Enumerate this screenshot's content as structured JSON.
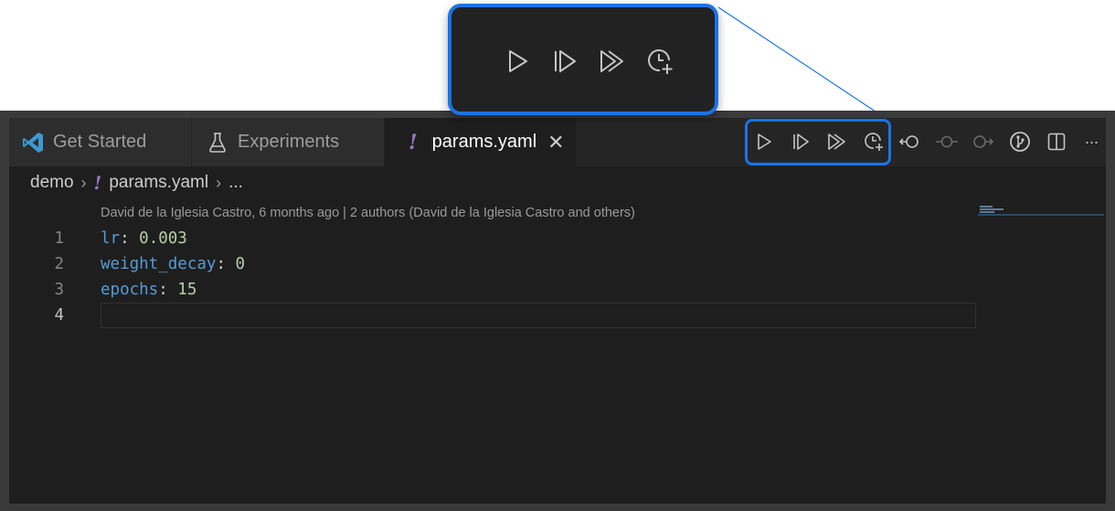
{
  "tabs": [
    {
      "label": "Get Started",
      "icon": "vscode-logo-icon",
      "active": false
    },
    {
      "label": "Experiments",
      "icon": "flask-icon",
      "active": false
    },
    {
      "label": "params.yaml",
      "icon": "yaml-file-icon",
      "active": true
    }
  ],
  "file_icon_glyph": "!",
  "close_glyph": "✕",
  "toolbar_icons": [
    "run-experiment-icon",
    "resume-experiment-icon",
    "run-all-experiments-icon",
    "queue-experiment-icon",
    "go-back-icon",
    "git-commit-icon",
    "go-forward-icon",
    "source-control-graph-icon",
    "split-editor-icon",
    "more-actions-icon"
  ],
  "more_glyph": "···",
  "breadcrumb": {
    "folder": "demo",
    "file": "params.yaml",
    "ellipsis": "...",
    "separator": "›"
  },
  "blame": "David de la Iglesia Castro, 6 months ago | 2 authors (David de la Iglesia Castro and others)",
  "code": [
    {
      "num": "1",
      "key": "lr",
      "colon": ": ",
      "value": "0.003"
    },
    {
      "num": "2",
      "key": "weight_decay",
      "colon": ": ",
      "value": "0"
    },
    {
      "num": "3",
      "key": "epochs",
      "colon": ": ",
      "value": "15"
    },
    {
      "num": "4",
      "key": "",
      "colon": "",
      "value": ""
    }
  ],
  "colors": {
    "accent": "#1a73e8",
    "key": "#569cd6",
    "number": "#b5cea8",
    "yaml": "#a074c4",
    "vscode": "#3c99d4"
  }
}
